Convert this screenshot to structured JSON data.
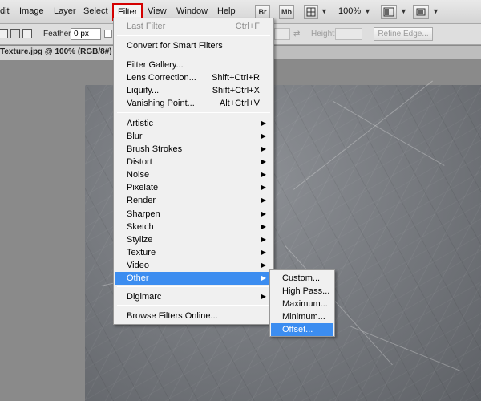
{
  "menubar": {
    "items": [
      "dit",
      "Image",
      "Layer",
      "Select",
      "Filter",
      "View",
      "Window",
      "Help"
    ],
    "bridge_label": "Br",
    "minibridge_label": "Mb",
    "zoom": "100%"
  },
  "options": {
    "feather_label": "Feather:",
    "feather_value": "0 px",
    "height_label": "Height:",
    "refine_edge": "Refine Edge..."
  },
  "document": {
    "tab_title": "Texture.jpg @ 100% (RGB/8#)"
  },
  "filter_menu": {
    "items": [
      {
        "label": "Last Filter",
        "shortcut": "Ctrl+F",
        "disabled": true
      },
      {
        "label": "Convert for Smart Filters"
      },
      {
        "label": "Filter Gallery..."
      },
      {
        "label": "Lens Correction...",
        "shortcut": "Shift+Ctrl+R"
      },
      {
        "label": "Liquify...",
        "shortcut": "Shift+Ctrl+X"
      },
      {
        "label": "Vanishing Point...",
        "shortcut": "Alt+Ctrl+V"
      },
      {
        "label": "Artistic",
        "submenu": true
      },
      {
        "label": "Blur",
        "submenu": true
      },
      {
        "label": "Brush Strokes",
        "submenu": true
      },
      {
        "label": "Distort",
        "submenu": true
      },
      {
        "label": "Noise",
        "submenu": true
      },
      {
        "label": "Pixelate",
        "submenu": true
      },
      {
        "label": "Render",
        "submenu": true
      },
      {
        "label": "Sharpen",
        "submenu": true
      },
      {
        "label": "Sketch",
        "submenu": true
      },
      {
        "label": "Stylize",
        "submenu": true
      },
      {
        "label": "Texture",
        "submenu": true
      },
      {
        "label": "Video",
        "submenu": true
      },
      {
        "label": "Other",
        "submenu": true,
        "active": true
      },
      {
        "label": "Digimarc",
        "submenu": true
      },
      {
        "label": "Browse Filters Online..."
      }
    ]
  },
  "other_submenu": {
    "items": [
      {
        "label": "Custom..."
      },
      {
        "label": "High Pass..."
      },
      {
        "label": "Maximum..."
      },
      {
        "label": "Minimum..."
      },
      {
        "label": "Offset...",
        "active": true
      }
    ]
  },
  "icons": {
    "submenu_arrow": "triangle-right-icon",
    "dropdown": "chevron-down-icon"
  },
  "colors": {
    "highlight": "#3c8df0",
    "filter_outline": "#d40000"
  }
}
